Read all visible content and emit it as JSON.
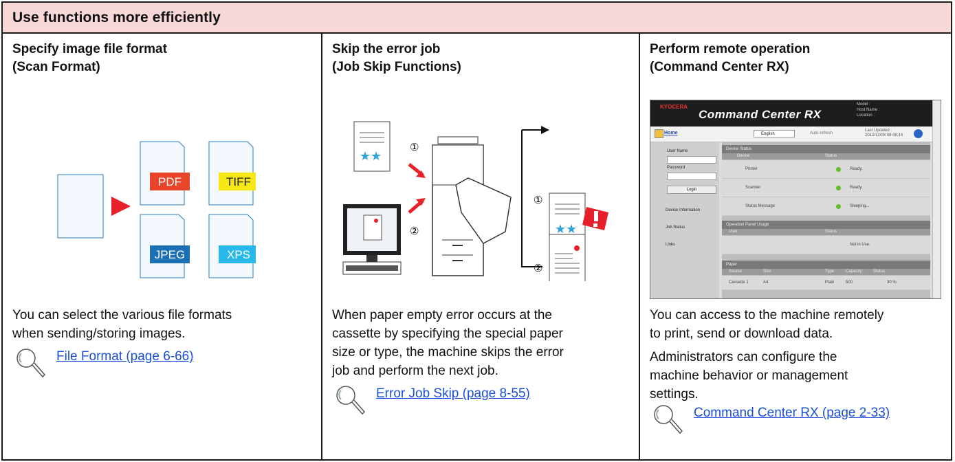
{
  "header": {
    "title": "Use functions more efficiently"
  },
  "columns": [
    {
      "title_line1": "Specify image file format",
      "title_line2": "(Scan Format)",
      "formats": [
        "PDF",
        "TIFF",
        "JPEG",
        "XPS"
      ],
      "desc": [
        "You can select the various file formats",
        "when sending/storing images."
      ],
      "link": "File Format (page 6-66)"
    },
    {
      "title_line1": "Skip the error job",
      "title_line2": "(Job Skip Functions)",
      "markers": [
        "①",
        "②",
        "①",
        "②"
      ],
      "desc": [
        "When paper empty error occurs at the",
        "cassette by specifying the special paper",
        "size or type, the machine skips the error",
        "job and perform the next job."
      ],
      "link": "Error Job Skip (page 8-55)"
    },
    {
      "title_line1": "Perform remote operation",
      "title_line2": "(Command Center RX)",
      "desc": [
        "You can access to the machine remotely",
        "to print, send or download data.",
        "Administrators can configure the",
        "machine behavior or management",
        "settings."
      ],
      "link": "Command Center RX (page 2-33)"
    }
  ],
  "ccrx": {
    "brand": "KYOCERA",
    "title": "Command Center RX",
    "meta": [
      "Model :",
      "Host Name :",
      "Location :"
    ],
    "home": "Home",
    "language": "English",
    "auto_refresh": "Auto-refresh",
    "last_updated_label": "Last Updated :",
    "last_updated": "2012/12/08 08:48:44",
    "user_name": "User Name",
    "password": "Password",
    "login": "Login",
    "nav": [
      "Device Information",
      "Job Status",
      "Links"
    ],
    "device_status": "Device Status",
    "col_device": "Device",
    "col_status": "Status",
    "devices": [
      {
        "name": "Printer",
        "status": "Ready."
      },
      {
        "name": "Scanner",
        "status": "Ready."
      },
      {
        "name": "Status Message",
        "status": "Sleeping..."
      }
    ],
    "op_panel": "Operation Panel Usage",
    "col_user": "User",
    "op_status": "Not in Use.",
    "paper": "Paper",
    "paper_cols": [
      "Source",
      "Size",
      "Type",
      "Capacity",
      "Status"
    ],
    "paper_row": [
      "Cassette 1",
      "A4",
      "Plain",
      "500",
      "30 %"
    ]
  },
  "colors": {
    "header_bg": "#f9d8d8",
    "link": "#1a4fd6",
    "pdf": "#e8452a",
    "tiff": "#f6e816",
    "jpeg": "#1c6fb3",
    "xps": "#28b9ea",
    "arrow": "#e8202a"
  }
}
